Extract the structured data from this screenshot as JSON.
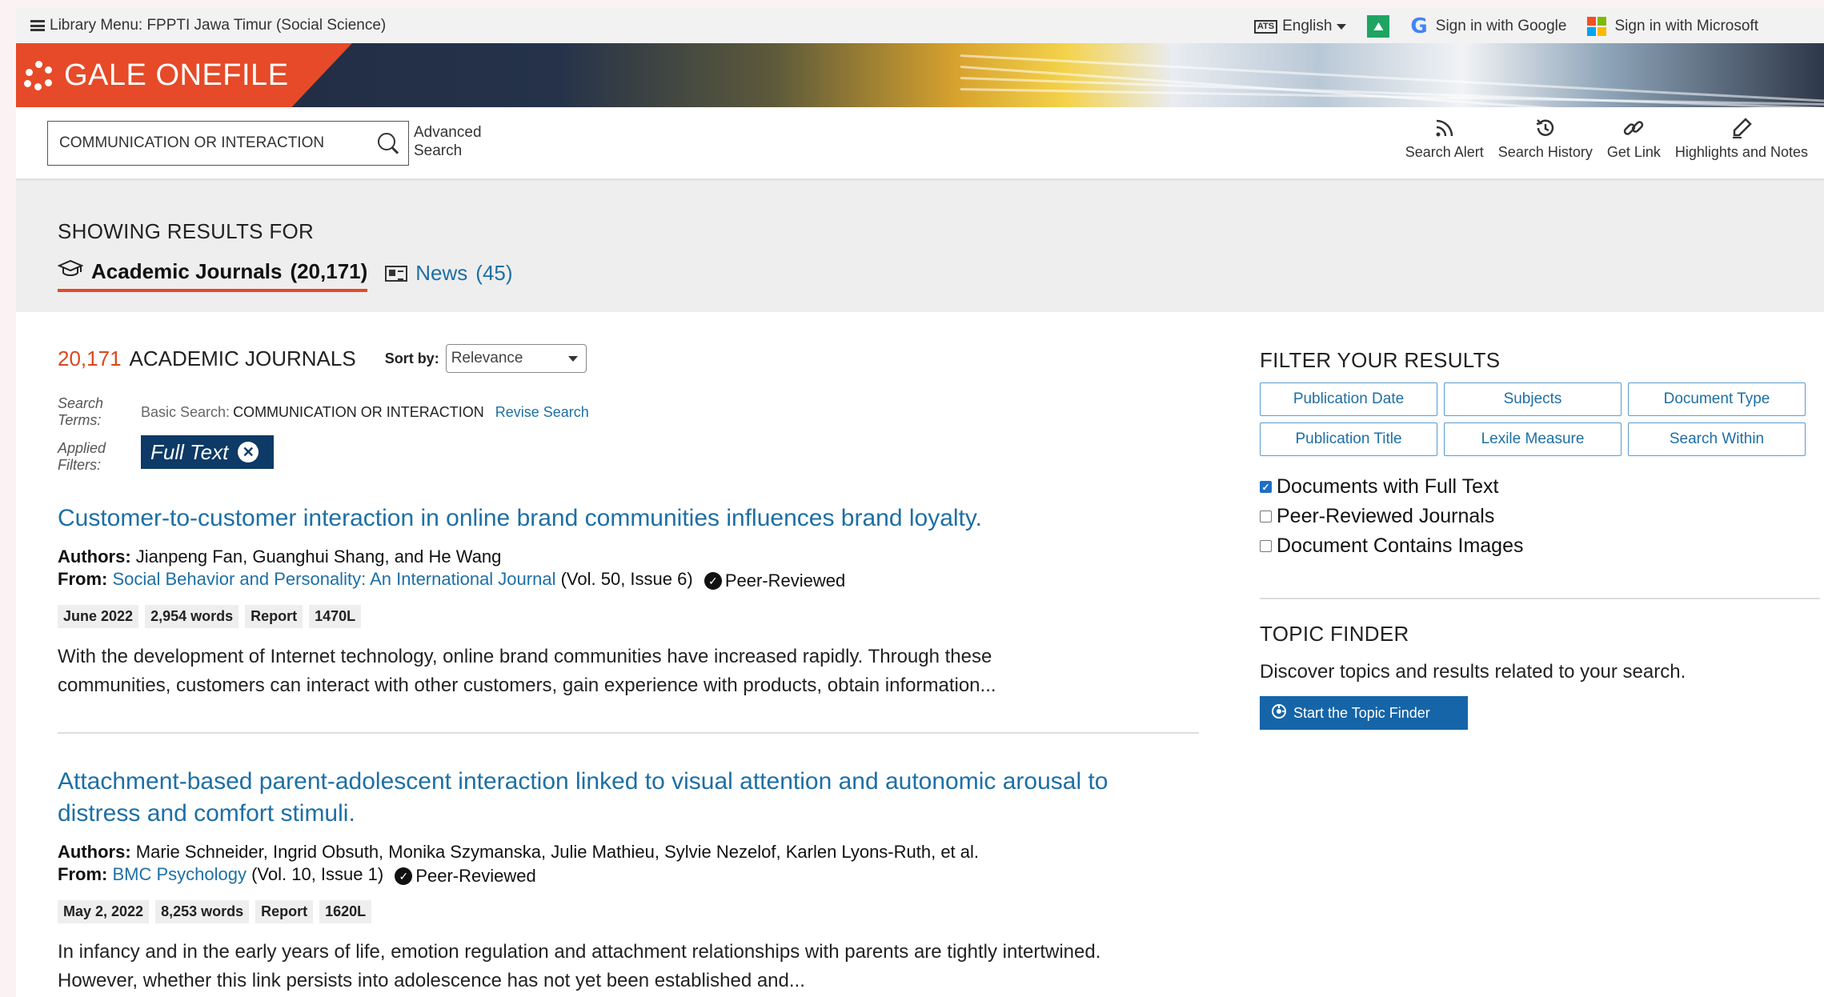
{
  "topbar": {
    "library_menu": "Library Menu: FPPTI Jawa Timur (Social Science)",
    "language": "English",
    "sign_in_google": "Sign in with Google",
    "sign_in_microsoft": "Sign in with Microsoft"
  },
  "banner": {
    "title": "GALE ONEFILE"
  },
  "search": {
    "query": "COMMUNICATION OR INTERACTION",
    "advanced_line1": "Advanced",
    "advanced_line2": "Search"
  },
  "tools": [
    {
      "label": "Search Alert",
      "icon": "rss-icon"
    },
    {
      "label": "Search History",
      "icon": "history-icon"
    },
    {
      "label": "Get Link",
      "icon": "link-icon"
    },
    {
      "label": "Highlights and Notes",
      "icon": "pen-icon"
    }
  ],
  "showing": {
    "heading": "SHOWING RESULTS FOR",
    "tabs": [
      {
        "label": "Academic Journals",
        "count": "(20,171)",
        "active": true,
        "icon": "graduation-cap-icon"
      },
      {
        "label": "News",
        "count": "(45)",
        "active": false,
        "icon": "newspaper-icon"
      }
    ]
  },
  "results_header": {
    "count": "20,171",
    "label": "ACADEMIC JOURNALS",
    "sort_label": "Sort by:",
    "sort_value": "Relevance"
  },
  "meta": {
    "search_terms_label_1": "Search",
    "search_terms_label_2": "Terms:",
    "basic_search_prefix": "Basic Search:",
    "basic_search_query": "COMMUNICATION OR INTERACTION",
    "revise_search": "Revise Search",
    "applied_filters_label_1": "Applied",
    "applied_filters_label_2": "Filters:",
    "filter_chip": "Full Text"
  },
  "results": [
    {
      "title": "Customer-to-customer interaction in online brand communities influences brand loyalty.",
      "authors_label": "Authors:",
      "authors": "Jianpeng Fan, Guanghui Shang, and He Wang",
      "from_label": "From:",
      "source": "Social Behavior and Personality: An International Journal",
      "issue": "(Vol. 50, Issue 6)",
      "peer_reviewed": "Peer-Reviewed",
      "tags": [
        "June 2022",
        "2,954 words",
        "Report",
        "1470L"
      ],
      "abstract_line1": "With the development of Internet technology, online brand communities have increased rapidly. Through these",
      "abstract_line2": "communities, customers can interact with other customers, gain experience with products, obtain information..."
    },
    {
      "title_line1": "Attachment-based parent-adolescent interaction linked to visual attention and autonomic arousal to",
      "title_line2": "distress and comfort stimuli.",
      "authors_label": "Authors:",
      "authors": "Marie Schneider, Ingrid Obsuth, Monika Szymanska, Julie Mathieu, Sylvie Nezelof, Karlen Lyons-Ruth, et al.",
      "from_label": "From:",
      "source": "BMC Psychology",
      "issue": "(Vol. 10, Issue 1)",
      "peer_reviewed": "Peer-Reviewed",
      "tags": [
        "May 2, 2022",
        "8,253 words",
        "Report",
        "1620L"
      ],
      "abstract_line1": "In infancy and in the early years of life, emotion regulation and attachment relationships with parents are tightly intertwined.",
      "abstract_line2": "However, whether this link persists into adolescence has not yet been established and..."
    }
  ],
  "filters": {
    "heading": "FILTER YOUR RESULTS",
    "buttons": [
      "Publication Date",
      "Subjects",
      "Document Type",
      "Publication Title",
      "Lexile Measure",
      "Search Within"
    ],
    "checkboxes": [
      {
        "label": "Documents with Full Text",
        "checked": true
      },
      {
        "label": "Peer-Reviewed Journals",
        "checked": false
      },
      {
        "label": "Document Contains Images",
        "checked": false
      }
    ]
  },
  "topic_finder": {
    "heading": "TOPIC FINDER",
    "description": "Discover topics and results related to your search.",
    "button": "Start the Topic Finder"
  },
  "colors": {
    "brand": "#e64a28",
    "link": "#1d6fa5",
    "chip": "#0d3a66",
    "count": "#d64a1f"
  }
}
